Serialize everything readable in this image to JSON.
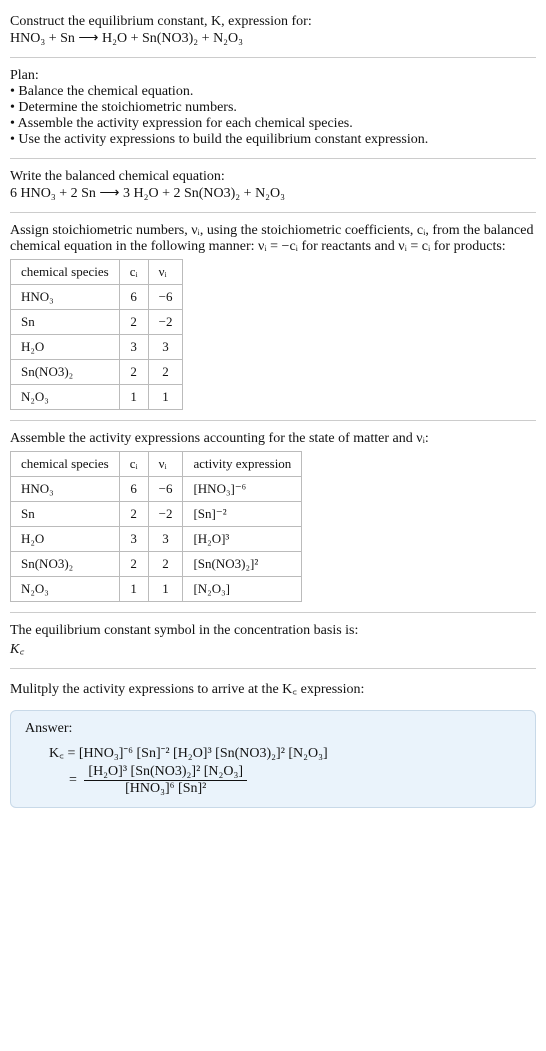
{
  "header": {
    "line1": "Construct the equilibrium constant, K, expression for:",
    "line2": "HNO₃ + Sn ⟶ H₂O + Sn(NO3)₂ + N₂O₃"
  },
  "plan": {
    "title": "Plan:",
    "b1": "• Balance the chemical equation.",
    "b2": "• Determine the stoichiometric numbers.",
    "b3": "• Assemble the activity expression for each chemical species.",
    "b4": "• Use the activity expressions to build the equilibrium constant expression."
  },
  "balanced": {
    "title": "Write the balanced chemical equation:",
    "eq": "6 HNO₃ + 2 Sn ⟶ 3 H₂O + 2 Sn(NO3)₂ + N₂O₃"
  },
  "assign": {
    "text": "Assign stoichiometric numbers, νᵢ, using the stoichiometric coefficients, cᵢ, from the balanced chemical equation in the following manner: νᵢ = −cᵢ for reactants and νᵢ = cᵢ for products:",
    "headers": {
      "h1": "chemical species",
      "h2": "cᵢ",
      "h3": "νᵢ"
    },
    "rows": [
      {
        "sp": "HNO₃",
        "c": "6",
        "v": "−6"
      },
      {
        "sp": "Sn",
        "c": "2",
        "v": "−2"
      },
      {
        "sp": "H₂O",
        "c": "3",
        "v": "3"
      },
      {
        "sp": "Sn(NO3)₂",
        "c": "2",
        "v": "2"
      },
      {
        "sp": "N₂O₃",
        "c": "1",
        "v": "1"
      }
    ]
  },
  "activity": {
    "text": "Assemble the activity expressions accounting for the state of matter and νᵢ:",
    "headers": {
      "h1": "chemical species",
      "h2": "cᵢ",
      "h3": "νᵢ",
      "h4": "activity expression"
    },
    "rows": [
      {
        "sp": "HNO₃",
        "c": "6",
        "v": "−6",
        "a": "[HNO₃]⁻⁶"
      },
      {
        "sp": "Sn",
        "c": "2",
        "v": "−2",
        "a": "[Sn]⁻²"
      },
      {
        "sp": "H₂O",
        "c": "3",
        "v": "3",
        "a": "[H₂O]³"
      },
      {
        "sp": "Sn(NO3)₂",
        "c": "2",
        "v": "2",
        "a": "[Sn(NO3)₂]²"
      },
      {
        "sp": "N₂O₃",
        "c": "1",
        "v": "1",
        "a": "[N₂O₃]"
      }
    ]
  },
  "symbol": {
    "text": "The equilibrium constant symbol in the concentration basis is:",
    "kc": "K꜀"
  },
  "multiply": {
    "text": "Mulitply the activity expressions to arrive at the K꜀ expression:"
  },
  "answer": {
    "label": "Answer:",
    "line1": "K꜀ = [HNO₃]⁻⁶ [Sn]⁻² [H₂O]³ [Sn(NO3)₂]² [N₂O₃]",
    "frac_num": "[H₂O]³ [Sn(NO3)₂]² [N₂O₃]",
    "frac_den": "[HNO₃]⁶ [Sn]²",
    "eq_prefix": "= "
  },
  "chart_data": {
    "type": "table",
    "title": "Stoichiometric numbers and activity expressions",
    "tables": [
      {
        "name": "stoichiometric",
        "columns": [
          "chemical species",
          "c_i",
          "ν_i"
        ],
        "rows": [
          [
            "HNO3",
            6,
            -6
          ],
          [
            "Sn",
            2,
            -2
          ],
          [
            "H2O",
            3,
            3
          ],
          [
            "Sn(NO3)2",
            2,
            2
          ],
          [
            "N2O3",
            1,
            1
          ]
        ]
      },
      {
        "name": "activity",
        "columns": [
          "chemical species",
          "c_i",
          "ν_i",
          "activity expression"
        ],
        "rows": [
          [
            "HNO3",
            6,
            -6,
            "[HNO3]^-6"
          ],
          [
            "Sn",
            2,
            -2,
            "[Sn]^-2"
          ],
          [
            "H2O",
            3,
            3,
            "[H2O]^3"
          ],
          [
            "Sn(NO3)2",
            2,
            2,
            "[Sn(NO3)2]^2"
          ],
          [
            "N2O3",
            1,
            1,
            "[N2O3]"
          ]
        ]
      }
    ]
  }
}
